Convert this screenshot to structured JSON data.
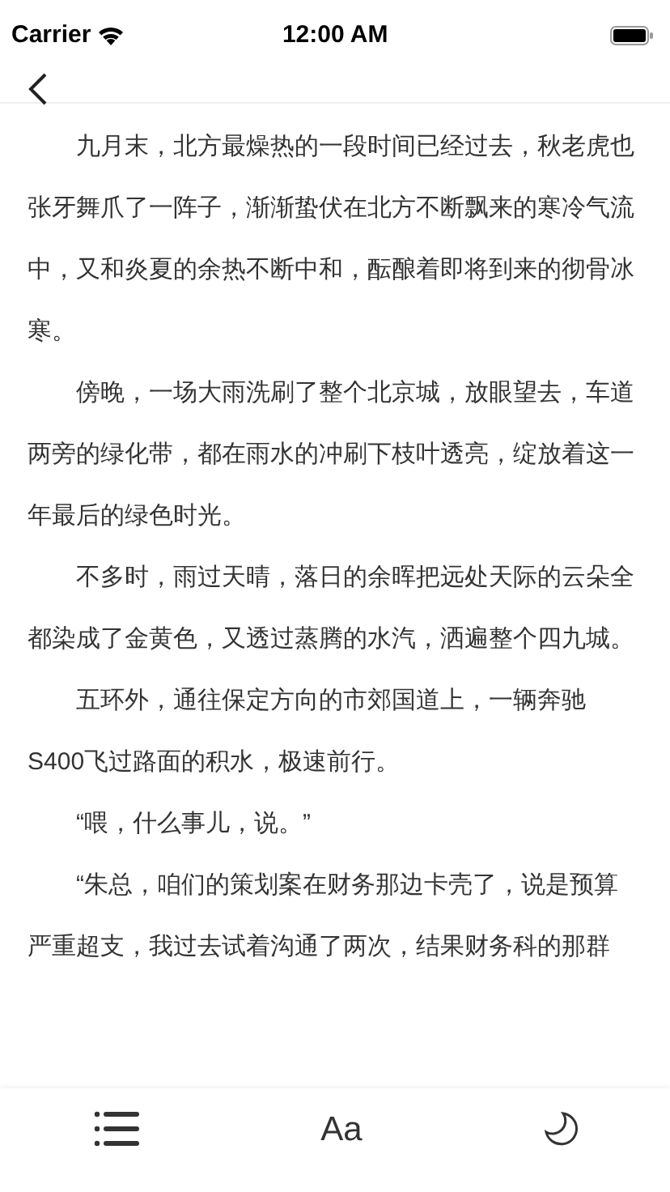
{
  "status_bar": {
    "carrier": "Carrier",
    "time": "12:00 AM"
  },
  "paragraphs": [
    "九月末，北方最燥热的一段时间已经过去，秋老虎也张牙舞爪了一阵子，渐渐蛰伏在北方不断飘来的寒冷气流中，又和炎夏的余热不断中和，酝酿着即将到来的彻骨冰寒。",
    "傍晚，一场大雨洗刷了整个北京城，放眼望去，车道两旁的绿化带，都在雨水的冲刷下枝叶透亮，绽放着这一年最后的绿色时光。",
    "不多时，雨过天晴，落日的余晖把远处天际的云朵全都染成了金黄色，又透过蒸腾的水汽，洒遍整个四九城。",
    "五环外，通往保定方向的市郊国道上，一辆奔驰S400飞过路面的积水，极速前行。",
    "“喂，什么事儿，说。”",
    "“朱总，咱们的策划案在财务那边卡壳了，说是预算严重超支，我过去试着沟通了两次，结果财务科的那群"
  ],
  "toolbar": {
    "font_button": "Aa"
  }
}
